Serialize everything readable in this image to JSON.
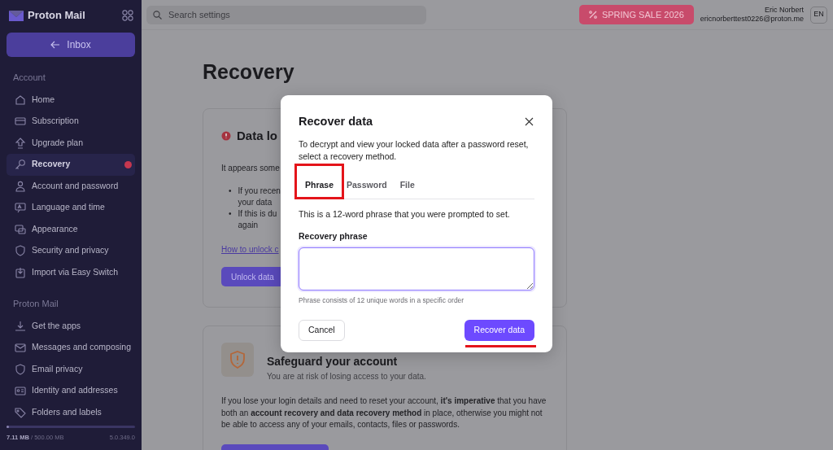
{
  "app": {
    "name": "Proton Mail",
    "inbox_button": "Inbox"
  },
  "sidebar": {
    "sections": [
      {
        "heading": "Account",
        "items": [
          {
            "label": "Home",
            "selected": false,
            "notification": false
          },
          {
            "label": "Subscription",
            "selected": false,
            "notification": false
          },
          {
            "label": "Upgrade plan",
            "selected": false,
            "notification": false
          },
          {
            "label": "Recovery",
            "selected": true,
            "notification": true
          },
          {
            "label": "Account and password",
            "selected": false,
            "notification": false
          },
          {
            "label": "Language and time",
            "selected": false,
            "notification": false
          },
          {
            "label": "Appearance",
            "selected": false,
            "notification": false
          },
          {
            "label": "Security and privacy",
            "selected": false,
            "notification": false
          },
          {
            "label": "Import via Easy Switch",
            "selected": false,
            "notification": false
          }
        ]
      },
      {
        "heading": "Proton Mail",
        "items": [
          {
            "label": "Get the apps",
            "selected": false,
            "notification": false
          },
          {
            "label": "Messages and composing",
            "selected": false,
            "notification": false
          },
          {
            "label": "Email privacy",
            "selected": false,
            "notification": false
          },
          {
            "label": "Identity and addresses",
            "selected": false,
            "notification": false
          },
          {
            "label": "Folders and labels",
            "selected": false,
            "notification": false
          }
        ]
      }
    ],
    "storage": {
      "used": "7.11 MB",
      "total": "/ 500.00 MB",
      "level": 0.02
    },
    "version": "5.0.349.0"
  },
  "topbar": {
    "search_placeholder": "Search settings",
    "promo_button": "SPRING SALE 2026",
    "user_name": "Eric Norbert",
    "user_email": "ericnorberttest0226@proton.me",
    "language_button": "EN"
  },
  "page": {
    "title": "Recovery",
    "data_locked_card": {
      "title": "Data lo",
      "intro": "It appears some",
      "bullets": [
        {
          "marker": "•",
          "lines": [
            "If you recen",
            "your data"
          ]
        },
        {
          "marker": "•",
          "lines": [
            "If this is du",
            "again"
          ]
        }
      ],
      "link": "How to unlock c",
      "button": "Unlock data"
    },
    "safeguard_card": {
      "title": "Safeguard your account",
      "subtitle": "You are at risk of losing access to your data.",
      "body": "If you lose your login details and need to reset your account, **it's imperative** that you have both an **account recovery and data recovery method** in place, otherwise you might not be able to access any of your emails, contacts, files or passwords."
    }
  },
  "modal": {
    "title": "Recover data",
    "description": "To decrypt and view your locked data after a password reset, select a recovery method.",
    "tabs": [
      {
        "label": "Phrase",
        "selected": true
      },
      {
        "label": "Password",
        "selected": false
      },
      {
        "label": "File",
        "selected": false
      }
    ],
    "tab_text": "This is a 12-word phrase that you were prompted to set.",
    "field_label": "Recovery phrase",
    "hint": "Phrase consists of 12 unique words in a specific order",
    "cancel_button": "Cancel",
    "submit_button": "Recover data"
  }
}
